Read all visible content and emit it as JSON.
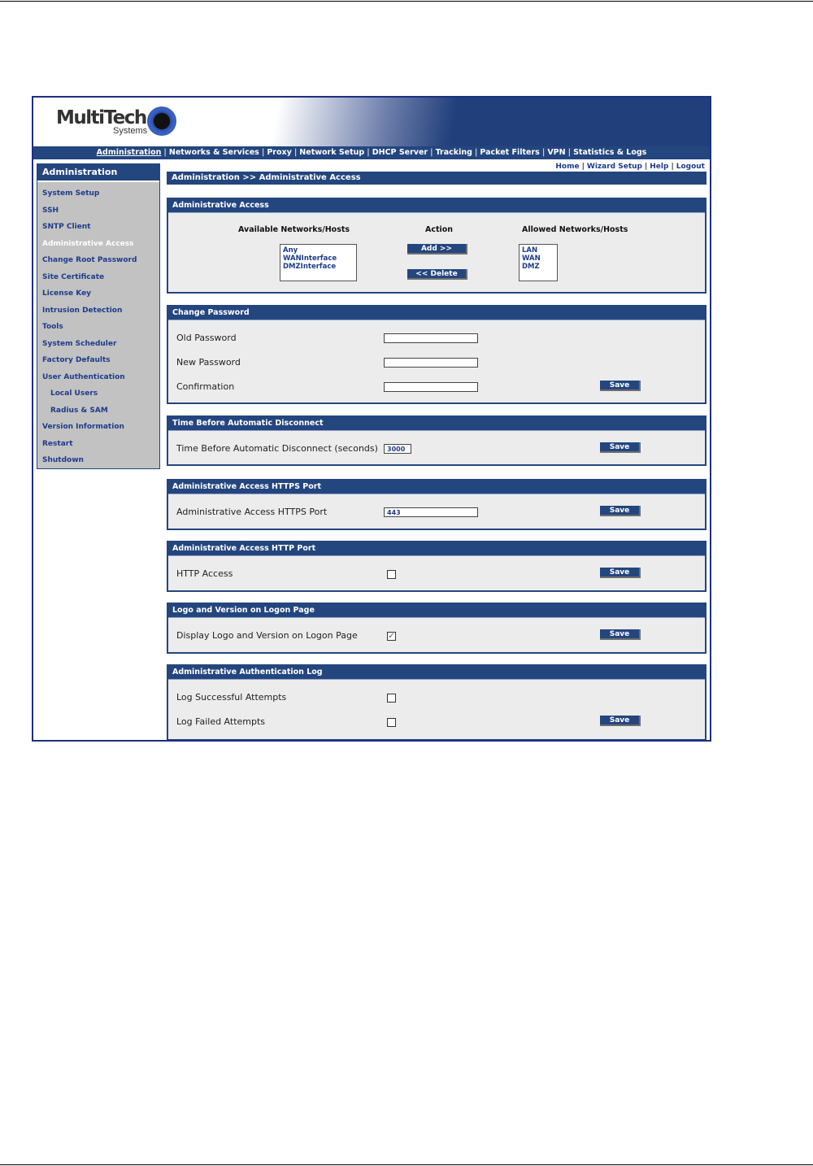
{
  "header": {
    "logo_main": "MultiTech",
    "logo_sub": "Systems"
  },
  "topnav": [
    {
      "label": "Administration",
      "active": true
    },
    {
      "label": "Networks & Services"
    },
    {
      "label": "Proxy"
    },
    {
      "label": "Network Setup"
    },
    {
      "label": "DHCP Server"
    },
    {
      "label": "Tracking"
    },
    {
      "label": "Packet Filters"
    },
    {
      "label": "VPN"
    },
    {
      "label": "Statistics & Logs"
    }
  ],
  "utility_links": [
    "Home",
    "Wizard Setup",
    "Help",
    "Logout"
  ],
  "sidebar": {
    "title": "Administration",
    "items": [
      {
        "label": "System Setup"
      },
      {
        "label": "SSH"
      },
      {
        "label": "SNTP Client"
      },
      {
        "label": "Administrative Access",
        "active": true
      },
      {
        "label": "Change Root Password"
      },
      {
        "label": "Site Certificate"
      },
      {
        "label": "License Key"
      },
      {
        "label": "Intrusion Detection"
      },
      {
        "label": "Tools"
      },
      {
        "label": "System Scheduler"
      },
      {
        "label": "Factory Defaults"
      },
      {
        "label": "User Authentication"
      },
      {
        "label": "Local Users",
        "sub": true
      },
      {
        "label": "Radius & SAM",
        "sub": true
      },
      {
        "label": "Version Information"
      },
      {
        "label": "Restart"
      },
      {
        "label": "Shutdown"
      }
    ]
  },
  "breadcrumb": "Administration >> Administrative Access",
  "admin_access": {
    "title": "Administrative Access",
    "available_header": "Available Networks/Hosts",
    "action_header": "Action",
    "allowed_header": "Allowed Networks/Hosts",
    "available": [
      "Any",
      "WANInterface",
      "DMZInterface"
    ],
    "allowed": [
      "LAN",
      "WAN",
      "DMZ"
    ],
    "add_label": "Add  >>",
    "delete_label": "<< Delete"
  },
  "change_password": {
    "title": "Change Password",
    "old_label": "Old Password",
    "new_label": "New Password",
    "confirm_label": "Confirmation",
    "save_label": "Save"
  },
  "disconnect": {
    "title": "Time Before Automatic Disconnect",
    "label": "Time Before Automatic Disconnect (seconds)",
    "value": "3000",
    "save_label": "Save"
  },
  "https_port": {
    "title": "Administrative Access HTTPS Port",
    "label": "Administrative Access HTTPS Port",
    "value": "443",
    "save_label": "Save"
  },
  "http_port": {
    "title": "Administrative Access HTTP Port",
    "label": "HTTP Access",
    "checked": false,
    "save_label": "Save"
  },
  "logo_version": {
    "title": "Logo and Version on Logon Page",
    "label": "Display Logo and Version on Logon Page",
    "checked": true,
    "checkmark": "✓",
    "save_label": "Save"
  },
  "auth_log": {
    "title": "Administrative Authentication Log",
    "success_label": "Log Successful Attempts",
    "failed_label": "Log Failed Attempts",
    "success_checked": false,
    "failed_checked": false,
    "save_label": "Save"
  }
}
